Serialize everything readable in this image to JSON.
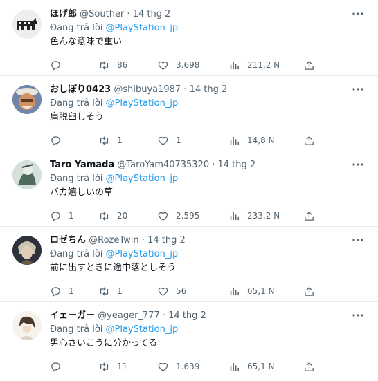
{
  "colors": {
    "accent": "#1d9bf0",
    "muted": "#536471",
    "text": "#0f1419",
    "divider": "#e7e9ea"
  },
  "reply_prefix": "Đang trả lời ",
  "tweets": [
    {
      "name": "ほげ郎",
      "handle": "@Souther",
      "dot": " · ",
      "date": "14 thg 2",
      "mention": "@PlayStation_jp",
      "text": "色んな意味で重い",
      "replies": "",
      "retweets": "86",
      "likes": "3.698",
      "views": "211,2 N"
    },
    {
      "name": "おしぼり0423",
      "handle": "@shibuya1987",
      "dot": " · ",
      "date": "14 thg 2",
      "mention": "@PlayStation_jp",
      "text": "肩脱臼しそう",
      "replies": "",
      "retweets": "1",
      "likes": "1",
      "views": "14,8 N"
    },
    {
      "name": "Taro Yamada",
      "handle": "@TaroYam40735320",
      "dot": " · ",
      "date": "14 thg 2",
      "mention": "@PlayStation_jp",
      "text": "バカ嬉しいの草",
      "replies": "1",
      "retweets": "20",
      "likes": "2.595",
      "views": "233,2 N"
    },
    {
      "name": "ロゼちん",
      "handle": "@RozeTwin",
      "dot": " · ",
      "date": "14 thg 2",
      "mention": "@PlayStation_jp",
      "text": "前に出すときに途中落としそう",
      "replies": "1",
      "retweets": "1",
      "likes": "56",
      "views": "65,1 N"
    },
    {
      "name": "イェーガー",
      "handle": "@yeager_777",
      "dot": " · ",
      "date": "14 thg 2",
      "mention": "@PlayStation_jp",
      "text": "男心さいこうに分かってる",
      "replies": "",
      "retweets": "11",
      "likes": "1.639",
      "views": "65,1 N"
    }
  ],
  "icons": [
    "reply-icon",
    "retweet-icon",
    "like-icon",
    "views-icon",
    "share-icon",
    "more-icon"
  ]
}
